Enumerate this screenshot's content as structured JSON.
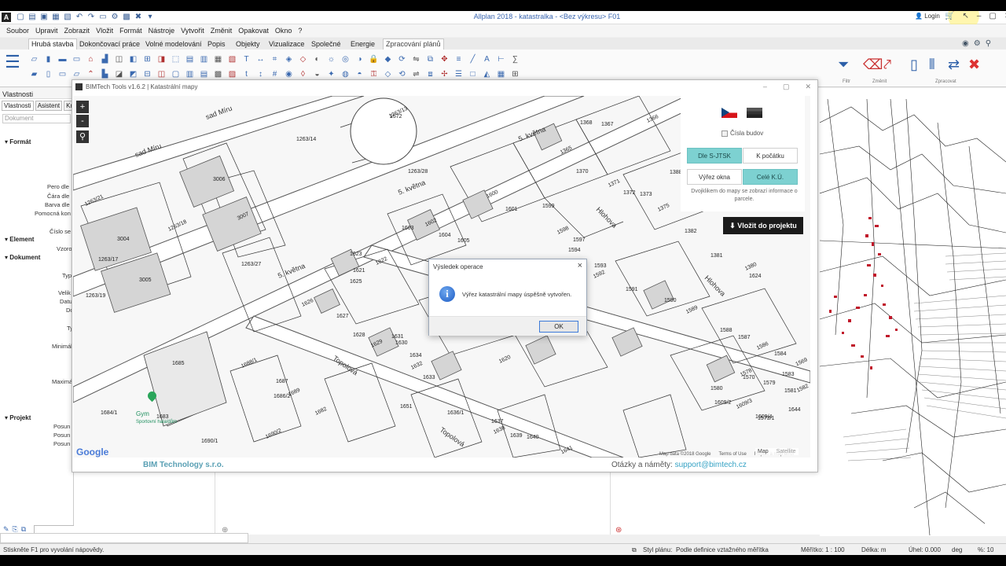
{
  "titlebar": {
    "logo": "A",
    "title": "Allplan 2018 - katastralka - <Bez výkresu> F01",
    "login": "Login"
  },
  "menu": [
    "Soubor",
    "Upravit",
    "Zobrazit",
    "Vložit",
    "Formát",
    "Nástroje",
    "Vytvořit",
    "Změnit",
    "Opakovat",
    "Okno",
    "?"
  ],
  "ribbon_tabs": [
    "Hrubá stavba",
    "Dokončovací práce",
    "Volné modelování",
    "Popis",
    "Objekty",
    "Vizualizace",
    "Společné",
    "Energie",
    "Zpracování plánů"
  ],
  "ribbon_groups": [
    "Filtr",
    "Změnit",
    "Zpracovat"
  ],
  "palette": {
    "title": "Vlastnosti",
    "tabs": [
      "Vlastnosti",
      "Asistent",
      "Kni"
    ],
    "field_placeholder": "Dokument",
    "sections": [
      "Formát",
      "Element",
      "Dokument",
      "Projekt"
    ],
    "lines": [
      "Pero dle",
      "Čára dle",
      "Barva dle",
      "Pomocná kon",
      "Číslo se",
      "Vzoro",
      "Typ",
      "Velik",
      "Datu",
      "Do",
      "Ty",
      "Minimál",
      "Maximál",
      "Posun",
      "Posun",
      "Posun"
    ]
  },
  "bimtech": {
    "title": "BIMTech Tools v1.6.2 | Katastrální mapy",
    "cislo_budov": "Čísla budov",
    "seg1": [
      "Dle S-JTSK",
      "K počátku"
    ],
    "seg2": [
      "Výřez okna",
      "Celé K.Ú."
    ],
    "hint": "Dvojklikem do mapy se zobrazí informace o parcele.",
    "vlozit": "Vložit do projektu",
    "map_btn": "Map",
    "satellite_btn": "Satellite",
    "google": "Google",
    "attribution": [
      "Map data ©2018 Google",
      "Terms of Use",
      "Report a map error"
    ],
    "gym_label": "Gym",
    "gym_sub": "Sportovní hala/dům",
    "company": "BIM Technology s.r.o.",
    "question": "Otázky a náměty:",
    "email": "support@bimtech.cz",
    "zoom_in": "+",
    "zoom_out": "-",
    "search_icon": "search-icon"
  },
  "map_labels": {
    "streets": [
      "sad Míru",
      "sad Míru",
      "5. května",
      "5. května",
      "5. května",
      "Hlohova",
      "Hlohova",
      "Topolová",
      "Topolová"
    ],
    "parcels": [
      "1263/13",
      "1263/14",
      "3006",
      "3007",
      "3004",
      "3005",
      "1263/18",
      "1263/28",
      "1263/27",
      "1263/21",
      "1263/17",
      "1263/19",
      "1600",
      "1601",
      "1599",
      "1598",
      "1597",
      "1603",
      "1602",
      "1604",
      "1605",
      "1365",
      "1368",
      "1367",
      "1366",
      "1370",
      "1388/6",
      "1371",
      "1372",
      "1373",
      "1375",
      "1382",
      "1381",
      "1380",
      "1624",
      "1623",
      "1622",
      "1621",
      "1625",
      "1626",
      "1627",
      "1628",
      "1629",
      "1630",
      "1631",
      "1632",
      "1633",
      "1634",
      "1620",
      "1594",
      "1593",
      "1592",
      "1591",
      "1590",
      "1589",
      "1588",
      "1587",
      "1586",
      "1584",
      "1583",
      "1582",
      "1581",
      "1580",
      "1578",
      "1579",
      "1609/2",
      "1609/3",
      "1609/4",
      "1685",
      "1688/1",
      "1687",
      "1686/2",
      "1689",
      "1684/1",
      "1683",
      "1682",
      "1651",
      "1690/1",
      "1690/2",
      "1636/1",
      "1637",
      "1638",
      "1639",
      "1640",
      "1641",
      "1644",
      "1573/1",
      "1569",
      "1570",
      "1572"
    ]
  },
  "dialog": {
    "title": "Výsledek operace",
    "message": "Výřez katastrální mapy úspěšně vytvořen.",
    "ok": "OK",
    "close": "×"
  },
  "status": {
    "help": "Stiskněte F1 pro vyvolání nápovědy.",
    "styl_label": "Styl plánu:",
    "styl_value": "Podle definice vztažného měřítka",
    "meritko": "Měřítko: 1 : 100",
    "delka": "Délka: m",
    "uhel": "Úhel: 0.000",
    "deg": "deg",
    "percent": "%: 10"
  },
  "colors": {
    "accent_teal": "#7dd1d1",
    "title_blue": "#3a66b0",
    "link_teal": "#35a2c4",
    "company_teal": "#5aa0b4"
  }
}
